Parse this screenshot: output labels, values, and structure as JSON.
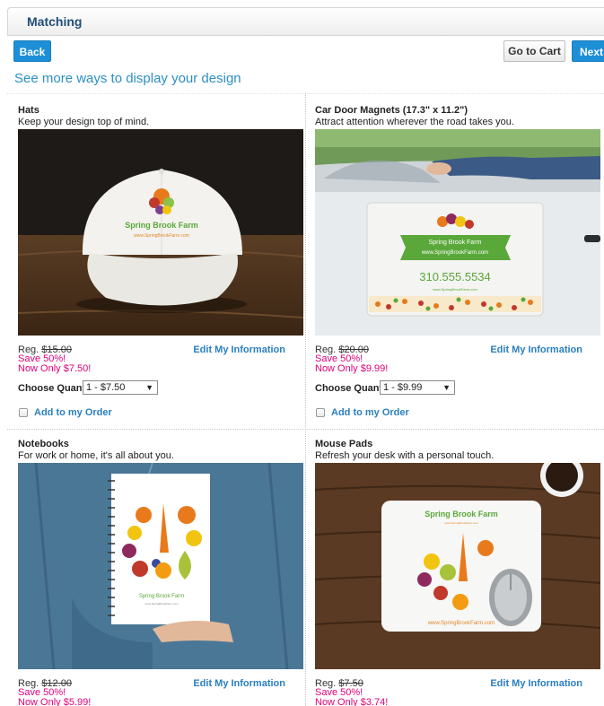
{
  "header": {
    "title": "Matching"
  },
  "nav": {
    "back": "Back",
    "cart": "Go to Cart",
    "next": "Next"
  },
  "subheading": "See more ways to display your design",
  "products": [
    {
      "name": "Hats",
      "tagline": "Keep your design top of mind.",
      "reg_label": "Reg.",
      "reg_price": "$15.00",
      "save": "Save 50%!",
      "now": "Now Only $7.50!",
      "edit": "Edit My Information",
      "qty_label": "Choose Quantity:",
      "qty_value": "1 - $7.50",
      "add": "Add to my Order",
      "photo_text": [
        "Spring Brook Farm",
        "www.SpringBrookFarm.com"
      ]
    },
    {
      "name": "Car Door Magnets (17.3\" x 11.2\")",
      "tagline": "Attract attention wherever the road takes you.",
      "reg_label": "Reg.",
      "reg_price": "$20.00",
      "save": "Save 50%!",
      "now": "Now Only $9.99!",
      "edit": "Edit My Information",
      "qty_label": "Choose Quantity:",
      "qty_value": "1 - $9.99",
      "add": "Add to my Order",
      "photo_text": [
        "Spring Brook Farm",
        "www.SpringBrookFarm.com",
        "310.555.5534",
        "www.SpringBrookFarm.com"
      ]
    },
    {
      "name": "Notebooks",
      "tagline": "For work or home, it's all about you.",
      "reg_label": "Reg.",
      "reg_price": "$12.00",
      "save": "Save 50%!",
      "now": "Now Only $5.99!",
      "edit": "Edit My Information",
      "photo_text": [
        "Spring Brook Farm",
        "www.SpringBrookFarm.com"
      ]
    },
    {
      "name": "Mouse Pads",
      "tagline": "Refresh your desk with a personal touch.",
      "reg_label": "Reg.",
      "reg_price": "$7.50",
      "save": "Save 50%!",
      "now": "Now Only $3.74!",
      "edit": "Edit My Information",
      "photo_text": [
        "Spring Brook Farm",
        "www.SpringBrookFarm.com",
        "www.SpringBrookFarm.com"
      ]
    }
  ],
  "colors": {
    "accent": "#1d8fd6",
    "sale": "#e0007a",
    "link": "#2a7fc0",
    "heading": "#1f4e79"
  }
}
